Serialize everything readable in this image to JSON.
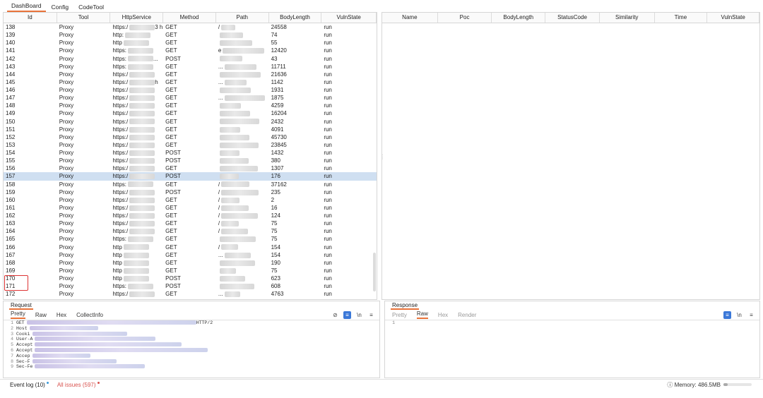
{
  "tabs": [
    "DashBoard",
    "Config",
    "CodeTool"
  ],
  "left_table": {
    "columns": [
      "Id",
      "Tool",
      "HttpService",
      "Method",
      "Path",
      "BodyLength",
      "VulnState"
    ],
    "rows": [
      {
        "id": "138",
        "tool": "Proxy",
        "svc": "https:/",
        "svc_tail": "3 h...",
        "method": "GET",
        "path": "/",
        "len": "24558",
        "state": "run"
      },
      {
        "id": "139",
        "tool": "Proxy",
        "svc": "http:",
        "svc_tail": "",
        "method": "GET",
        "path": "",
        "len": "74",
        "state": "run"
      },
      {
        "id": "140",
        "tool": "Proxy",
        "svc": "http",
        "svc_tail": "",
        "method": "GET",
        "path": "",
        "len": "55",
        "state": "run"
      },
      {
        "id": "141",
        "tool": "Proxy",
        "svc": "https:",
        "svc_tail": "",
        "method": "GET",
        "path": "e",
        "len": "12420",
        "state": "run"
      },
      {
        "id": "142",
        "tool": "Proxy",
        "svc": "https:",
        "svc_tail": "...",
        "method": "POST",
        "path": "",
        "len": "43",
        "state": "run"
      },
      {
        "id": "143",
        "tool": "Proxy",
        "svc": "https:",
        "svc_tail": "",
        "method": "GET",
        "path": "...",
        "len": "11711",
        "state": "run"
      },
      {
        "id": "144",
        "tool": "Proxy",
        "svc": "https:/",
        "svc_tail": "",
        "method": "GET",
        "path": "",
        "len": "21636",
        "state": "run"
      },
      {
        "id": "145",
        "tool": "Proxy",
        "svc": "https:/",
        "svc_tail": "h",
        "method": "GET",
        "path": "...",
        "len": "1142",
        "state": "run"
      },
      {
        "id": "146",
        "tool": "Proxy",
        "svc": "https:/",
        "svc_tail": "",
        "method": "GET",
        "path": "",
        "len": "1931",
        "state": "run"
      },
      {
        "id": "147",
        "tool": "Proxy",
        "svc": "https:/",
        "svc_tail": "",
        "method": "GET",
        "path": "...",
        "len": "1875",
        "state": "run"
      },
      {
        "id": "148",
        "tool": "Proxy",
        "svc": "https:/",
        "svc_tail": "",
        "method": "GET",
        "path": "",
        "len": "4259",
        "state": "run"
      },
      {
        "id": "149",
        "tool": "Proxy",
        "svc": "https:/",
        "svc_tail": "",
        "method": "GET",
        "path": "",
        "len": "16204",
        "state": "run"
      },
      {
        "id": "150",
        "tool": "Proxy",
        "svc": "https:/",
        "svc_tail": "",
        "method": "GET",
        "path": "",
        "len": "2432",
        "state": "run"
      },
      {
        "id": "151",
        "tool": "Proxy",
        "svc": "https:/",
        "svc_tail": "",
        "method": "GET",
        "path": "",
        "len": "4091",
        "state": "run"
      },
      {
        "id": "152",
        "tool": "Proxy",
        "svc": "https:/",
        "svc_tail": "",
        "method": "GET",
        "path": "",
        "len": "45730",
        "state": "run"
      },
      {
        "id": "153",
        "tool": "Proxy",
        "svc": "https:/",
        "svc_tail": "",
        "method": "GET",
        "path": "",
        "len": "23845",
        "state": "run"
      },
      {
        "id": "154",
        "tool": "Proxy",
        "svc": "https:/",
        "svc_tail": "",
        "method": "POST",
        "path": "",
        "len": "1432",
        "state": "run"
      },
      {
        "id": "155",
        "tool": "Proxy",
        "svc": "https:/",
        "svc_tail": "",
        "method": "POST",
        "path": "",
        "len": "380",
        "state": "run"
      },
      {
        "id": "156",
        "tool": "Proxy",
        "svc": "https:/",
        "svc_tail": "",
        "method": "GET",
        "path": "",
        "len": "1307",
        "state": "run"
      },
      {
        "id": "157",
        "tool": "Proxy",
        "svc": "https:/",
        "svc_tail": "",
        "method": "POST",
        "path": "",
        "len": "176",
        "state": "run"
      },
      {
        "id": "158",
        "tool": "Proxy",
        "svc": "https:",
        "svc_tail": "",
        "method": "GET",
        "path": "/",
        "len": "37162",
        "state": "run"
      },
      {
        "id": "159",
        "tool": "Proxy",
        "svc": "https:/",
        "svc_tail": "",
        "method": "POST",
        "path": "/",
        "len": "235",
        "state": "run"
      },
      {
        "id": "160",
        "tool": "Proxy",
        "svc": "https:/",
        "svc_tail": "",
        "method": "GET",
        "path": "/",
        "len": "2",
        "state": "run"
      },
      {
        "id": "161",
        "tool": "Proxy",
        "svc": "https:/",
        "svc_tail": "",
        "method": "GET",
        "path": "/",
        "len": "16",
        "state": "run"
      },
      {
        "id": "162",
        "tool": "Proxy",
        "svc": "https:/",
        "svc_tail": "",
        "method": "GET",
        "path": "/",
        "len": "124",
        "state": "run"
      },
      {
        "id": "163",
        "tool": "Proxy",
        "svc": "https:/",
        "svc_tail": "",
        "method": "GET",
        "path": "/",
        "len": "75",
        "state": "run"
      },
      {
        "id": "164",
        "tool": "Proxy",
        "svc": "https:/",
        "svc_tail": "",
        "method": "GET",
        "path": "/",
        "len": "75",
        "state": "run"
      },
      {
        "id": "165",
        "tool": "Proxy",
        "svc": "https:",
        "svc_tail": "",
        "method": "GET",
        "path": "",
        "len": "75",
        "state": "run"
      },
      {
        "id": "166",
        "tool": "Proxy",
        "svc": "http",
        "svc_tail": "",
        "method": "GET",
        "path": "/",
        "len": "154",
        "state": "run"
      },
      {
        "id": "167",
        "tool": "Proxy",
        "svc": "http",
        "svc_tail": "",
        "method": "GET",
        "path": "...",
        "len": "154",
        "state": "run"
      },
      {
        "id": "168",
        "tool": "Proxy",
        "svc": "http",
        "svc_tail": "",
        "method": "GET",
        "path": "",
        "len": "190",
        "state": "run"
      },
      {
        "id": "169",
        "tool": "Proxy",
        "svc": "http",
        "svc_tail": "",
        "method": "GET",
        "path": "",
        "len": "75",
        "state": "run"
      },
      {
        "id": "170",
        "tool": "Proxy",
        "svc": "http",
        "svc_tail": "",
        "method": "POST",
        "path": "",
        "len": "623",
        "state": "run"
      },
      {
        "id": "171",
        "tool": "Proxy",
        "svc": "https:",
        "svc_tail": "",
        "method": "POST",
        "path": "",
        "len": "608",
        "state": "run"
      },
      {
        "id": "172",
        "tool": "Proxy",
        "svc": "https:/",
        "svc_tail": "",
        "method": "GET",
        "path": "...",
        "len": "4763",
        "state": "run"
      }
    ],
    "selected_id": "157"
  },
  "right_table": {
    "columns": [
      "Name",
      "Poc",
      "BodyLength",
      "StatusCode",
      "Similarity",
      "Time",
      "VulnState"
    ]
  },
  "request": {
    "title": "Request",
    "subtabs": [
      "Pretty",
      "Raw",
      "Hex",
      "CollectInfo"
    ],
    "active_subtab": "Pretty",
    "lines": [
      {
        "n": "1",
        "text": "GET",
        "tail": "HTTP/2"
      },
      {
        "n": "2",
        "text": "Host",
        "tail": ""
      },
      {
        "n": "3",
        "text": "Cooki",
        "tail": ""
      },
      {
        "n": "4",
        "text": "User-A",
        "tail": ""
      },
      {
        "n": "5",
        "text": "Accept",
        "tail": ""
      },
      {
        "n": "6",
        "text": "Accept",
        "tail": ""
      },
      {
        "n": "7",
        "text": "Accep",
        "tail": ""
      },
      {
        "n": "8",
        "text": "Sec-F",
        "tail": ""
      },
      {
        "n": "9",
        "text": "Sec-Fe",
        "tail": ""
      }
    ]
  },
  "response": {
    "title": "Response",
    "subtabs": [
      "Pretty",
      "Raw",
      "Hex",
      "Render"
    ],
    "active_subtab": "Raw",
    "line1": "1"
  },
  "status": {
    "event_log": "Event log (10)",
    "all_issues": "All issues (597)",
    "memory": "Memory: 486.5MB"
  },
  "colors": {
    "accent": "#e8733a",
    "selected_row": "#cfdff1",
    "issues": "#d9534f",
    "highlight_box": "#dd3333"
  }
}
